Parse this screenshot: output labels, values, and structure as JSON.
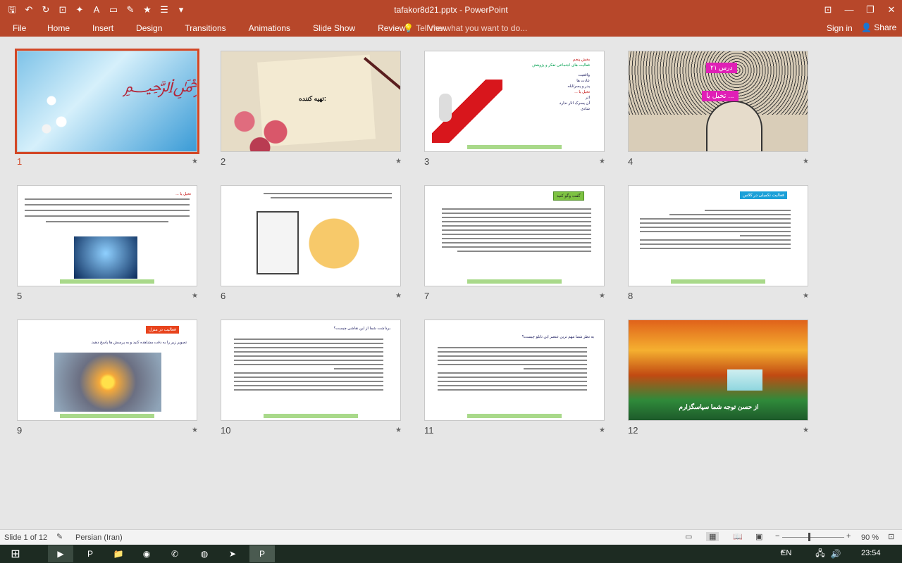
{
  "window": {
    "title": "tafakor8d21.pptx - PowerPoint"
  },
  "ribbon": {
    "file": "File",
    "tabs": [
      "Home",
      "Insert",
      "Design",
      "Transitions",
      "Animations",
      "Slide Show",
      "Review",
      "View"
    ],
    "tell_me": "Tell me what you want to do...",
    "sign_in": "Sign in",
    "share": "Share"
  },
  "slides": [
    {
      "number": "1",
      "selected": true
    },
    {
      "number": "2",
      "text": "تهیه کننده:"
    },
    {
      "number": "3",
      "lines": [
        "بخش پنجم",
        "فعالیت های اجتماعی تفکر و پژوهش",
        "واقعیت",
        "عادت ها",
        "پدر و پسر/ابله",
        "تخیل یا ...",
        "اثر",
        "آن پسرک اثار ندارد.",
        "شادی"
      ]
    },
    {
      "number": "4",
      "badge1": "درس ۲۱",
      "badge2": "تخیل یا ..."
    },
    {
      "number": "5",
      "text": "تخیل یا ..."
    },
    {
      "number": "6"
    },
    {
      "number": "7",
      "badge": "گفت وگو کنید"
    },
    {
      "number": "8",
      "badge": "فعالیت تکمیلی در کلاس"
    },
    {
      "number": "9",
      "badge": "فعالیت در منزل",
      "text": "تصویر زیر را به دقت مشاهده کنید و به پرسش ها پاسخ دهید."
    },
    {
      "number": "10",
      "text": "برداشت شما از این نقاشی چیست؟"
    },
    {
      "number": "11",
      "text": "به نظر شما مهم ترین عنصر این تابلو چیست؟"
    },
    {
      "number": "12",
      "text": "از حسن توجه شما سپاسگزارم"
    }
  ],
  "status": {
    "slide": "Slide 1 of 12",
    "language": "Persian (Iran)",
    "zoom": "90 %"
  },
  "taskbar": {
    "lang": "EN",
    "time": "23:54"
  }
}
